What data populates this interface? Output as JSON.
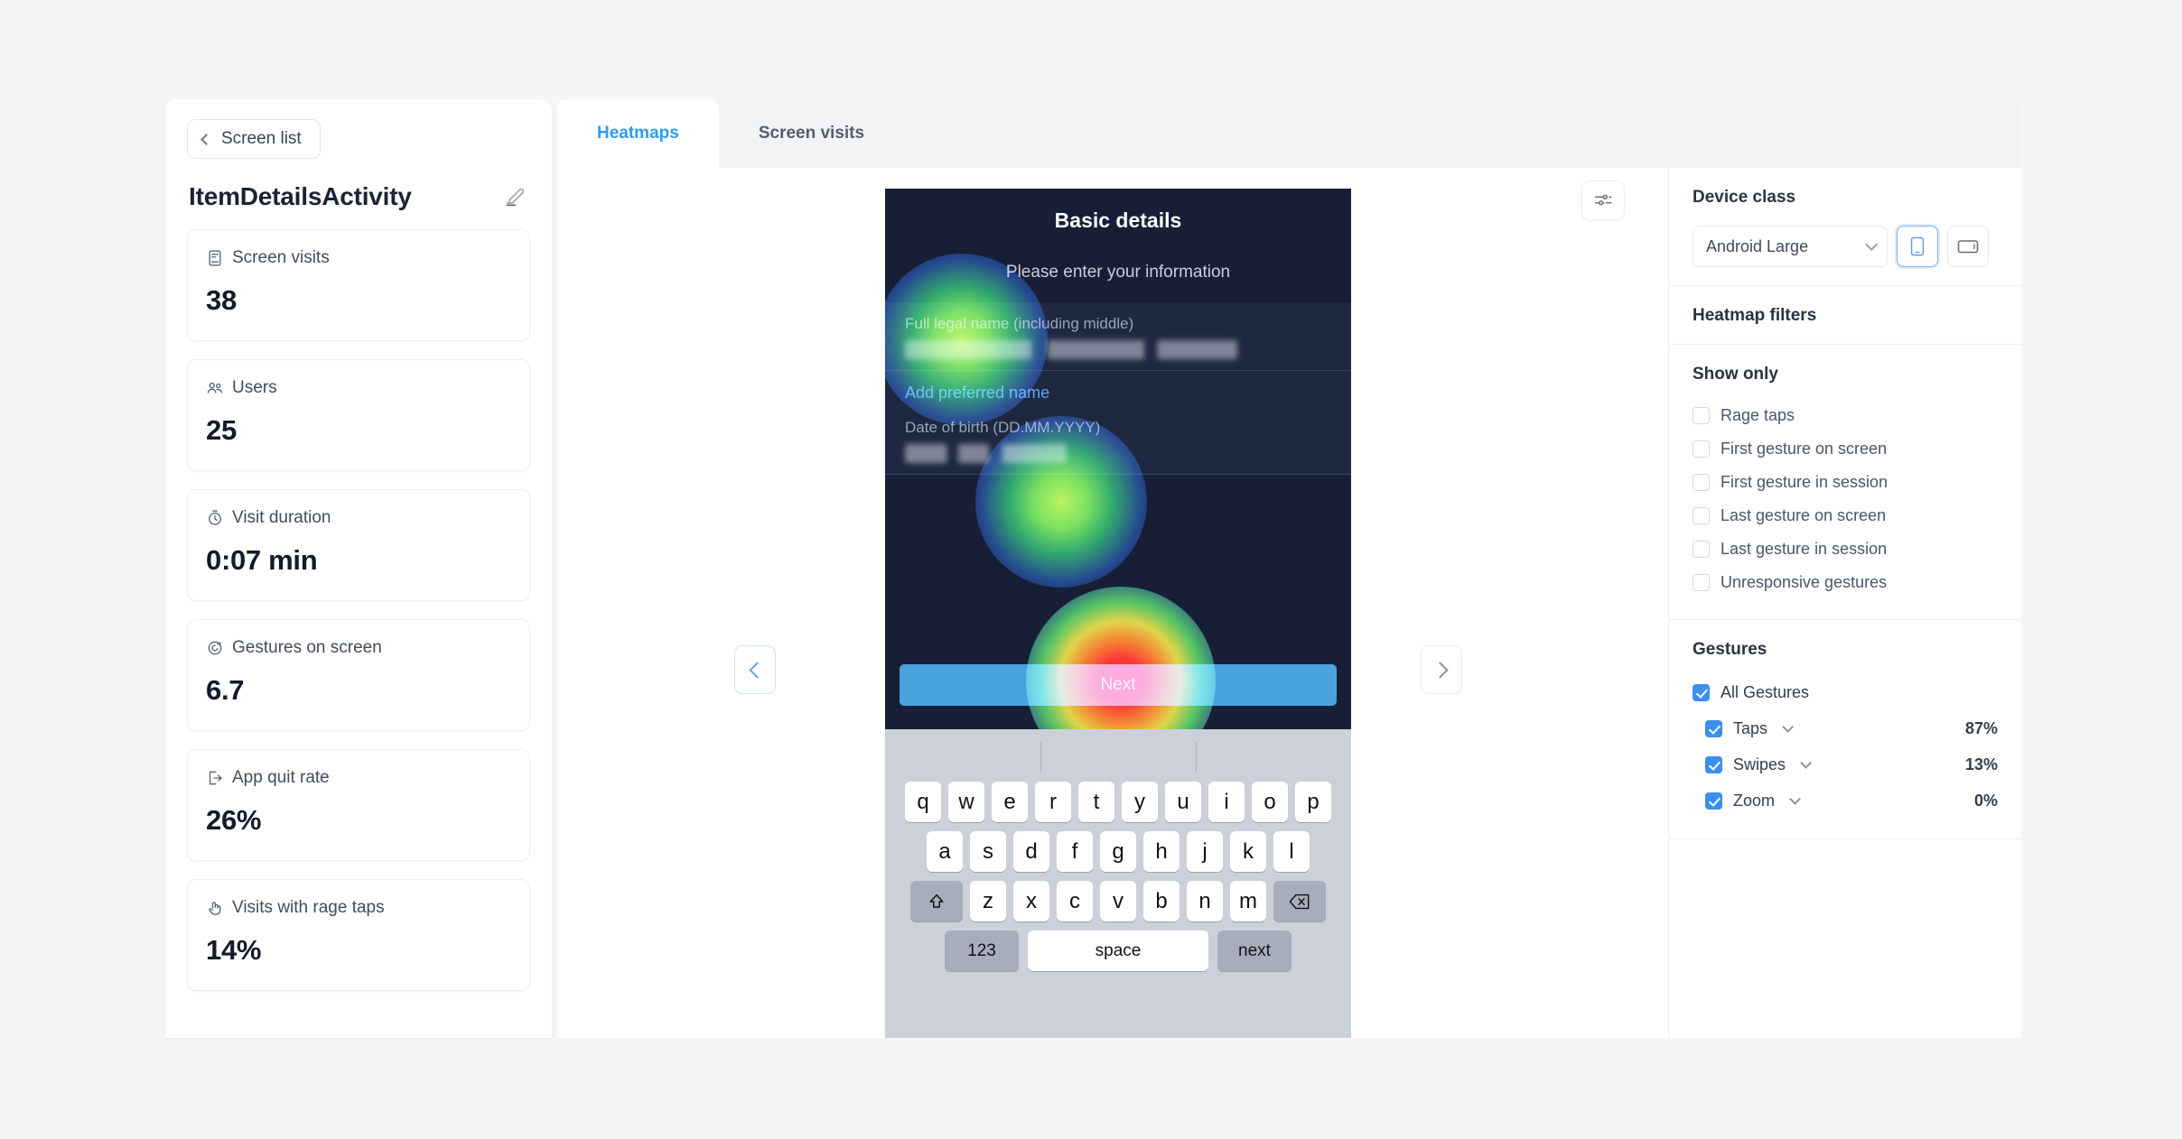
{
  "sidebar": {
    "back_button": "Screen list",
    "screen_title": "ItemDetailsActivity",
    "metrics": [
      {
        "label": "Screen visits",
        "value": "38",
        "icon": "phone-screen-icon"
      },
      {
        "label": "Users",
        "value": "25",
        "icon": "users-icon"
      },
      {
        "label": "Visit duration",
        "value": "0:07 min",
        "icon": "stopwatch-icon"
      },
      {
        "label": "Gestures on screen",
        "value": "6.7",
        "icon": "gesture-icon"
      },
      {
        "label": "App quit rate",
        "value": "26%",
        "icon": "exit-icon"
      },
      {
        "label": "Visits with rage taps",
        "value": "14%",
        "icon": "rage-tap-icon"
      }
    ]
  },
  "tabs": [
    {
      "label": "Heatmaps",
      "active": true
    },
    {
      "label": "Screen visits",
      "active": false
    }
  ],
  "phone": {
    "title": "Basic details",
    "subtitle": "Please enter your information",
    "fields": [
      {
        "label": "Full legal name (including middle)",
        "value_redacted": true
      },
      {
        "label": "Date of birth (DD.MM.YYYY)",
        "value_redacted": true
      }
    ],
    "link": "Add preferred name",
    "next_button": "Next",
    "keyboard": {
      "row1": [
        "q",
        "w",
        "e",
        "r",
        "t",
        "y",
        "u",
        "i",
        "o",
        "p"
      ],
      "row2": [
        "a",
        "s",
        "d",
        "f",
        "g",
        "h",
        "j",
        "k",
        "l"
      ],
      "row3": [
        "z",
        "x",
        "c",
        "v",
        "b",
        "n",
        "m"
      ],
      "shift": "shift-icon",
      "backspace": "backspace-icon",
      "num_key": "123",
      "space_key": "space",
      "next_key": "next"
    }
  },
  "right_panel": {
    "device_class_title": "Device class",
    "device_class_value": "Android Large",
    "device_buttons": [
      {
        "icon": "phone-portrait-icon",
        "active": true
      },
      {
        "icon": "tablet-landscape-icon",
        "active": false
      }
    ],
    "heatmap_filters_title": "Heatmap filters",
    "show_only_title": "Show only",
    "show_only": [
      {
        "label": "Rage taps",
        "checked": false
      },
      {
        "label": "First gesture on screen",
        "checked": false
      },
      {
        "label": "First gesture in session",
        "checked": false
      },
      {
        "label": "Last gesture on screen",
        "checked": false
      },
      {
        "label": "Last gesture in session",
        "checked": false
      },
      {
        "label": "Unresponsive gestures",
        "checked": false
      }
    ],
    "gestures_title": "Gestures",
    "all_gestures": {
      "label": "All Gestures",
      "checked": true
    },
    "gestures": [
      {
        "label": "Taps",
        "percent": "87%",
        "checked": true
      },
      {
        "label": "Swipes",
        "percent": "13%",
        "checked": true
      },
      {
        "label": "Zoom",
        "percent": "0%",
        "checked": true
      }
    ]
  },
  "colors": {
    "accent": "#2e9bf0",
    "phone_bg": "#161f35",
    "next_button": "#4aa3dd",
    "checkbox_on": "#3b8ef0",
    "page_bg": "#f4f5f7"
  }
}
